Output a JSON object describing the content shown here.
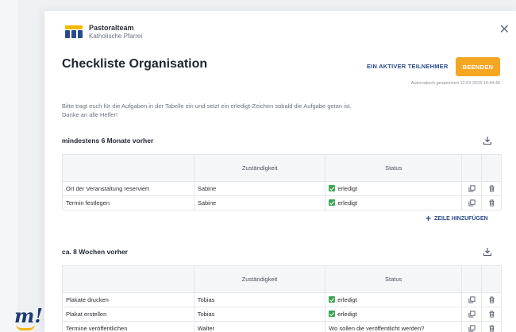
{
  "org": {
    "name": "Pastoralteam",
    "subtitle": "Katholische Pfarrei"
  },
  "page": {
    "title": "Checkliste Organisation",
    "participants_label": "EIN AKTIVER TEILNEHMER",
    "end_label": "BEENDEN",
    "autosave": "Automatisch gespeichert 12.02.2024 14:44:46",
    "intro_line1": "Bitte tragt euch für die Aufgaben in der Tabelle ein und setzt ein erledigt-Zeichen sobald die Aufgabe getan ist.",
    "intro_line2": "Danke an alle Helfer!"
  },
  "columns": {
    "responsible": "Zuständigkeit",
    "status": "Status"
  },
  "sections": [
    {
      "title": "mindestens 6 Monate vorher",
      "rows": [
        {
          "task": "Ort der Veranstaltung reserviert",
          "responsible": "Sabine",
          "status": "erledigt",
          "done": true
        },
        {
          "task": "Termin festlegen",
          "responsible": "Sabine",
          "status": "erledigt",
          "done": true
        }
      ],
      "add_row_label": "ZEILE HINZUFÜGEN"
    },
    {
      "title": "ca. 8 Wochen vorher",
      "rows": [
        {
          "task": "Plakate drucken",
          "responsible": "Tobias",
          "status": "erledigt",
          "done": true
        },
        {
          "task": "Plakat erstellen",
          "responsible": "Tobias",
          "status": "erledigt",
          "done": true
        },
        {
          "task": "Termine veröffentlichen",
          "responsible": "Walter",
          "status": "Wo sollen die veröffentlicht werden?",
          "done": false
        }
      ]
    }
  ],
  "icons": {
    "close": "close-icon",
    "download": "download-icon",
    "copy": "copy-icon",
    "delete": "trash-icon"
  },
  "colors": {
    "accent": "#f5a623",
    "primary": "#2a4a8a",
    "done": "#3aa655"
  }
}
